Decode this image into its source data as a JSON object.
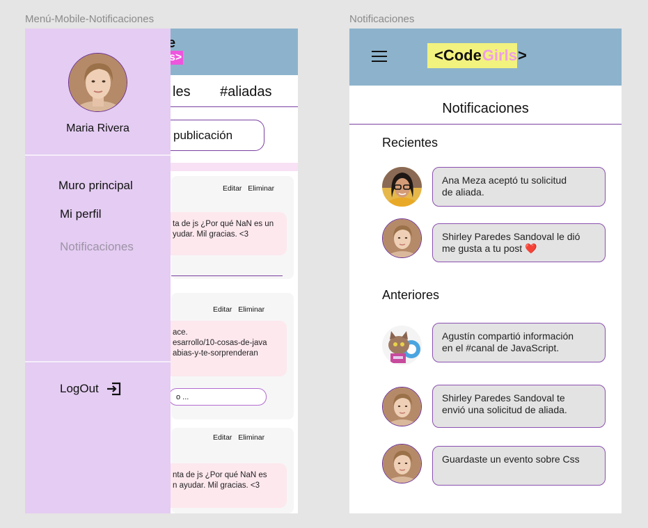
{
  "frames": {
    "left_label": "Menú-Mobile-Notificaciones",
    "right_label": "Notificaciones"
  },
  "left": {
    "background": {
      "logo_partial": "e",
      "logo_pink_partial": "s>",
      "tab_partial": "les",
      "tab_aliadas": "#aliadas",
      "publish_partial": "publicación",
      "cards": [
        {
          "edit": "Editar",
          "delete": "Eliminar",
          "lines": [
            "ta de js ¿Por qué NaN es un",
            "yudar. Mil gracias. <3"
          ]
        },
        {
          "edit": "Editar",
          "delete": "Eliminar",
          "lines": [
            "ace.",
            "esarrollo/10-cosas-de-java",
            "abias-y-te-sorprenderan"
          ]
        },
        {
          "edit": "Editar",
          "delete": "Eliminar",
          "lines": [
            "nta de js ¿Por qué NaN es",
            "n ayudar. Mil gracias. <3"
          ]
        }
      ],
      "comment_partial": "o ..."
    },
    "drawer": {
      "user_name": "Maria Rivera",
      "items": [
        "Muro principal",
        "Mi perfil",
        "Notificaciones"
      ],
      "logout": "LogOut"
    }
  },
  "right": {
    "logo": {
      "code": "<Code",
      "girls": "Girls",
      "close": ">"
    },
    "title": "Notificaciones",
    "sections": {
      "recent": "Recientes",
      "older": "Anteriores"
    },
    "notifications": [
      {
        "line1": "Ana Meza aceptó tu solicitud",
        "line2": "de aliada."
      },
      {
        "line1": "Shirley Paredes Sandoval  le dió",
        "line2": "me gusta a tu post",
        "heart": "❤️"
      },
      {
        "line1": "Agustín compartió información",
        "line2": "en el  #canal de JavaScript."
      },
      {
        "line1": "Shirley Paredes Sandoval te",
        "line2": "envió una solicitud de aliada."
      },
      {
        "line1": "Guardaste un evento sobre Css",
        "line2": ""
      }
    ]
  },
  "colors": {
    "header": "#8db3cc",
    "drawer": "#e4ccf2",
    "accent_purple": "#7a3fa0",
    "logo_highlight": "#f2f27e",
    "logo_girls": "#ee9fe6",
    "bubble_bg": "#e3e3e3",
    "bg_bubble_pink": "#fde8ee"
  }
}
